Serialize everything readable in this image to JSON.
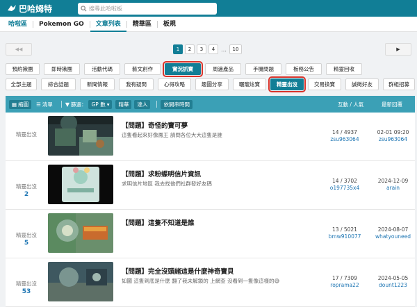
{
  "header": {
    "logo_text": "巴哈姆特",
    "search_placeholder": "搜尋此哈啦板"
  },
  "boardnav": {
    "items": [
      "哈啦區",
      "Pokemon GO",
      "文章列表",
      "精華區",
      "板規"
    ],
    "active_index": 2
  },
  "pager": {
    "prev_icon": "double-left-arrow",
    "next_icon": "play-right-arrow",
    "pages": [
      "1",
      "2",
      "3",
      "4"
    ],
    "current_page": "1",
    "dots": "…",
    "last_page": "10"
  },
  "categories": {
    "row1": [
      "預約揪團",
      "即時揪團",
      "活動代碼",
      "藝文創作",
      "實況抓寶",
      "周邊產品",
      "手機問題",
      "板務公告",
      "精靈回收"
    ],
    "row2": [
      "全部主題",
      "綜合話題",
      "新聞情報",
      "我有疑問",
      "心得攻略",
      "趣圖分享",
      "曬寵炫寶",
      "精靈出沒",
      "交易換寶",
      "誠徵好友",
      "群組招募"
    ],
    "active_row1": "實況抓寶",
    "active_row2": "精靈出沒"
  },
  "toolbar": {
    "view_thumb": "縮圖",
    "view_list": "清單",
    "filter_label": "篩選：",
    "filter_value": "GP 數",
    "btn_essence": "精華",
    "btn_expert": "達人",
    "btn_sort": "依開串時間",
    "col_interact": "互動 / 人氣",
    "col_latest": "最新回覆"
  },
  "posts": [
    {
      "category": "精靈出沒",
      "gp": "",
      "title": "【問題】奇怪的寶可夢",
      "snippet": "這隻看起來好像鳳王 請問各位大大這隻是誰",
      "stats": "14 / 4937",
      "author": "zsu963064",
      "time": "02-01 09:20",
      "last_user": "zsu963064"
    },
    {
      "category": "精靈出沒",
      "gp": "2",
      "title": "【問題】求粉蝶明信片資訊",
      "snippet": "求明信片地區 我去找他們社群發好友碼",
      "stats": "14 / 3702",
      "author": "o197735x4",
      "time": "2024-12-09",
      "last_user": "arain"
    },
    {
      "category": "精靈出沒",
      "gp": "5",
      "title": "【問題】這隻不知道是誰",
      "snippet": "",
      "stats": "13 / 5021",
      "author": "bmw910077",
      "time": "2024-08-07",
      "last_user": "whatyouneed"
    },
    {
      "category": "精靈出沒",
      "gp": "53",
      "title": "【問題】完全沒頭緒這是什麼神奇寶貝",
      "snippet": "如圖 這隻到底是什麼 翻了我未解鎖的 上網查 沒看到一隻像這樣的😅",
      "stats": "17 / 7309",
      "author": "roprama22",
      "time": "2024-05-05",
      "last_user": "dount1223"
    }
  ],
  "colors": {
    "brand": "#117e96",
    "toolbar": "#3ba0b6",
    "highlight": "#d9342b",
    "link": "#1d75b3"
  }
}
